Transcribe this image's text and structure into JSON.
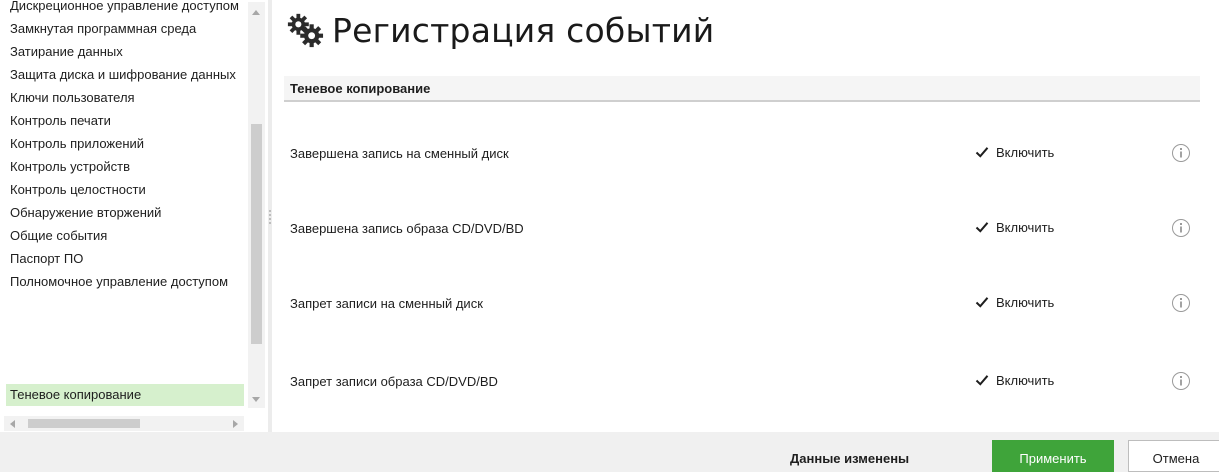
{
  "sidebar": {
    "items": [
      {
        "label": "Дискреционное управление доступом",
        "selected": false
      },
      {
        "label": "Замкнутая программная среда",
        "selected": false
      },
      {
        "label": "Затирание данных",
        "selected": false
      },
      {
        "label": "Защита диска и шифрование данных",
        "selected": false
      },
      {
        "label": "Ключи пользователя",
        "selected": false
      },
      {
        "label": "Контроль печати",
        "selected": false
      },
      {
        "label": "Контроль приложений",
        "selected": false
      },
      {
        "label": "Контроль устройств",
        "selected": false
      },
      {
        "label": "Контроль целостности",
        "selected": false
      },
      {
        "label": "Обнаружение вторжений",
        "selected": false
      },
      {
        "label": "Общие события",
        "selected": false
      },
      {
        "label": "Паспорт ПО",
        "selected": false
      },
      {
        "label": "Полномочное управление доступом",
        "selected": false
      },
      {
        "label": "Теневое копирование",
        "selected": true
      }
    ]
  },
  "main": {
    "title": "Регистрация событий",
    "title_icon": "gears-icon",
    "section_title": "Теневое копирование",
    "events": [
      {
        "label": "Завершена запись на сменный диск",
        "check_label": "Включить",
        "checked": true
      },
      {
        "label": "Завершена запись образа CD/DVD/BD",
        "check_label": "Включить",
        "checked": true
      },
      {
        "label": "Запрет записи на сменный диск",
        "check_label": "Включить",
        "checked": true
      },
      {
        "label": "Запрет записи образа CD/DVD/BD",
        "check_label": "Включить",
        "checked": true
      }
    ]
  },
  "footer": {
    "status": "Данные изменены",
    "apply_label": "Применить",
    "cancel_label": "Отмена"
  },
  "colors": {
    "selected_item_bg": "#d6f0cd",
    "apply_button": "#3fa43a",
    "footer_bg": "#f0f0f0"
  }
}
